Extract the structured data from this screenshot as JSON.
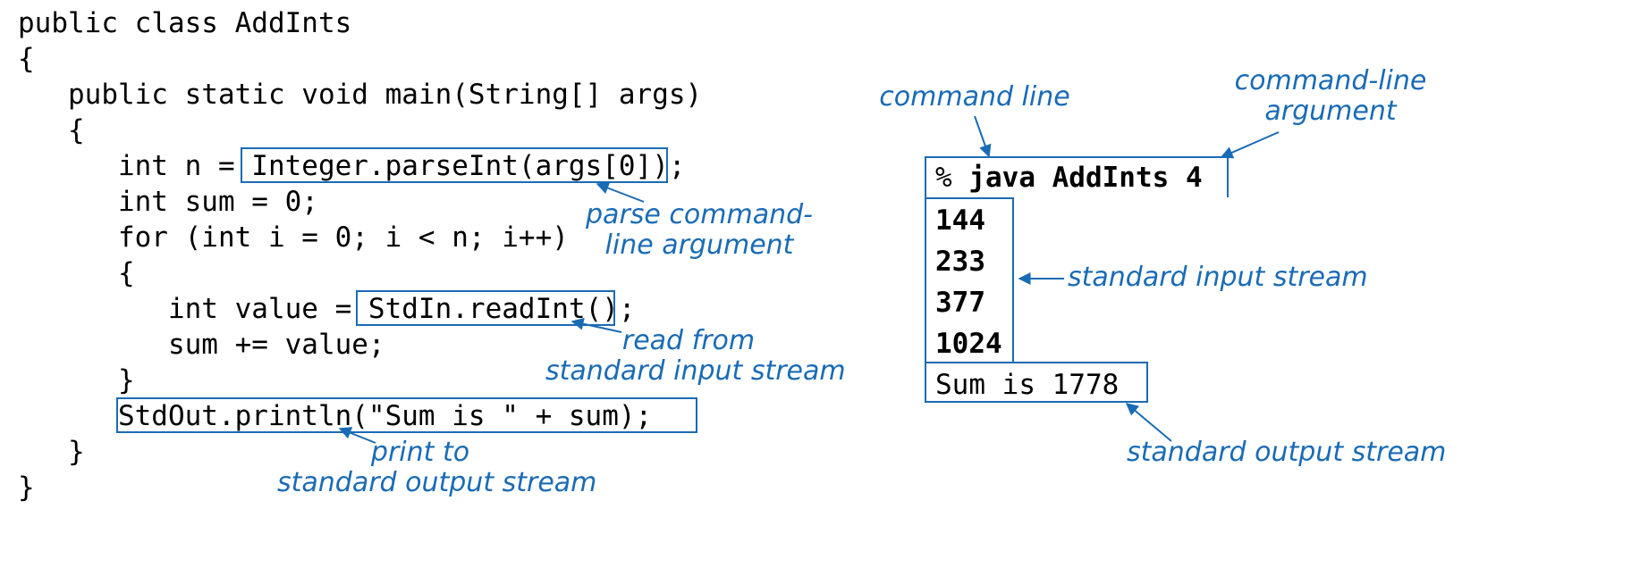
{
  "code": {
    "l1": "public class AddInts",
    "l2": "{",
    "l3": "   public static void main(String[] args)",
    "l4": "   {",
    "l5": "      int n = Integer.parseInt(args[0]);",
    "l6": "      int sum = 0;",
    "l7": "      for (int i = 0; i < n; i++)",
    "l8": "      {",
    "l9": "         int value = StdIn.readInt();",
    "l10": "         sum += value;",
    "l11": "      }",
    "l12": "      StdOut.println(\"Sum is \" + sum);",
    "l13": "   }",
    "l14": "}"
  },
  "annotations": {
    "parse": "parse command-\nline argument",
    "readstdin": "read from\nstandard input stream",
    "printstdout": "print to\nstandard output stream",
    "cmdline": "command line",
    "cmdarg": "command-line\nargument",
    "stdin": "standard input stream",
    "stdout": "standard output stream"
  },
  "terminal": {
    "prompt": "% ",
    "command": "java AddInts 4",
    "inputs": [
      "144",
      "233",
      "377",
      "1024"
    ],
    "output": "Sum is 1778"
  },
  "colors": {
    "annotation": "#1a6bb5",
    "box_border": "#1a6bb5"
  }
}
